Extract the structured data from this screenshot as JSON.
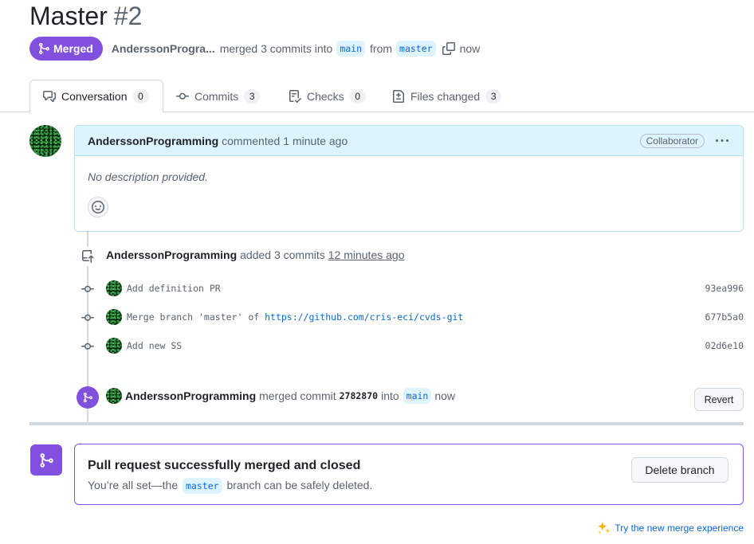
{
  "header": {
    "title": "Master",
    "number": "#2",
    "state": "Merged",
    "author": "AnderssonProgra...",
    "action": "merged 3 commits into",
    "base_branch": "main",
    "from_text": "from",
    "head_branch": "master",
    "time": "now"
  },
  "tabs": [
    {
      "label": "Conversation",
      "count": "0",
      "icon": "comment-discussion-icon"
    },
    {
      "label": "Commits",
      "count": "3",
      "icon": "git-commit-icon"
    },
    {
      "label": "Checks",
      "count": "0",
      "icon": "checklist-icon"
    },
    {
      "label": "Files changed",
      "count": "3",
      "icon": "file-diff-icon"
    }
  ],
  "comment": {
    "author": "AnderssonProgramming",
    "action": "commented",
    "time": "1 minute ago",
    "role": "Collaborator",
    "body": "No description provided."
  },
  "commits_event": {
    "author": "AnderssonProgramming",
    "action": "added 3 commits",
    "time": "12 minutes ago"
  },
  "commits": [
    {
      "message": "Add definition PR",
      "sha": "93ea996"
    },
    {
      "message": "Merge branch 'master' of ",
      "link": "https://github.com/cris-eci/cvds-git",
      "sha": "677b5a0"
    },
    {
      "message": "Add new SS",
      "sha": "02d6e10"
    }
  ],
  "merged_event": {
    "author": "AnderssonProgramming",
    "action": "merged commit",
    "sha": "2782870",
    "into": "into",
    "branch": "main",
    "time": "now",
    "revert_label": "Revert"
  },
  "merge_box": {
    "heading": "Pull request successfully merged and closed",
    "sub_before": "You’re all set—the",
    "branch": "master",
    "sub_after": "branch can be safely deleted.",
    "delete_label": "Delete branch"
  },
  "footer": {
    "try_label": "Try the new merge experience"
  },
  "colors": {
    "merged_purple": "#8250df",
    "link_blue": "#0969da",
    "comment_header_bg": "#ddf4ff"
  }
}
